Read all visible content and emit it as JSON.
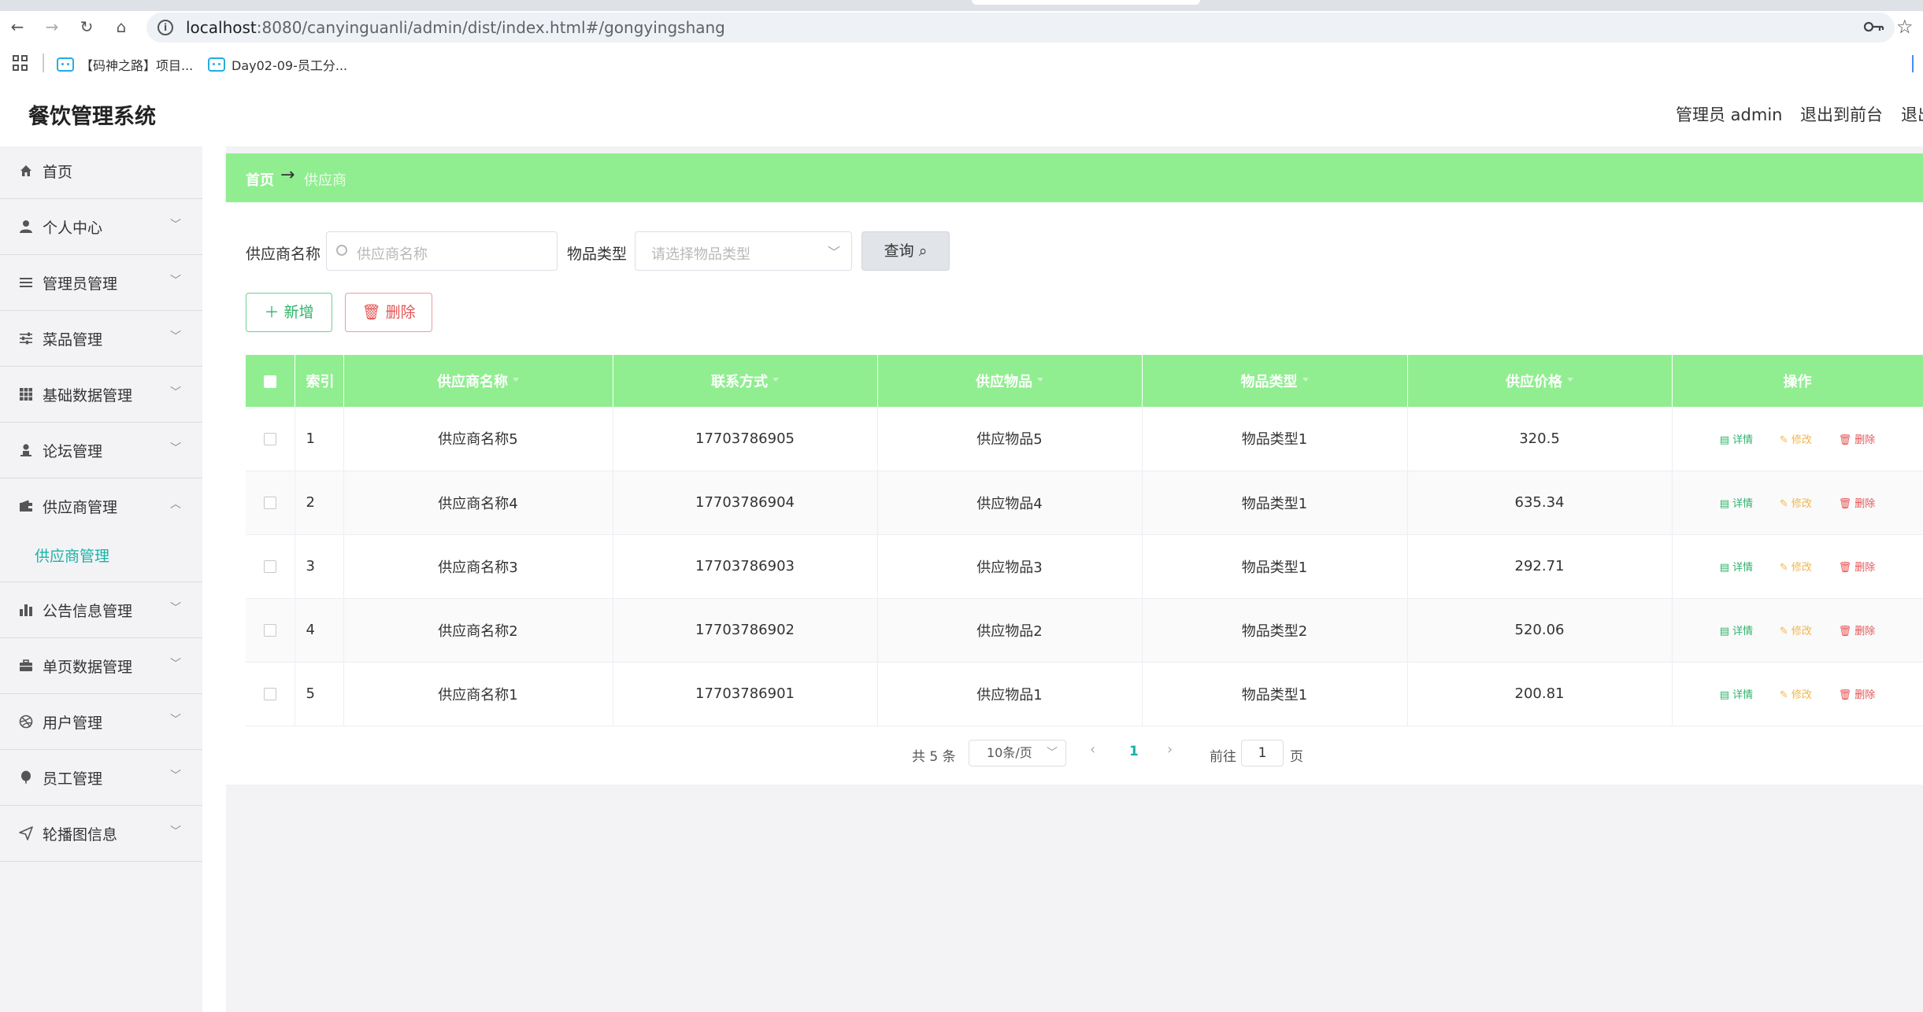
{
  "browser": {
    "url_host": "localhost",
    "url_path": ":8080/canyinguanli/admin/dist/index.html#/gongyingshang",
    "bookmarks": [
      "【码神之路】项目...",
      "Day02-09-员工分..."
    ]
  },
  "header": {
    "title": "餐饮管理系统",
    "user": "管理员 admin",
    "to_front": "退出到前台",
    "logout": "退出"
  },
  "sidebar": {
    "items": [
      {
        "label": "首页",
        "icon": "home-icon"
      },
      {
        "label": "个人中心",
        "icon": "user-icon"
      },
      {
        "label": "管理员管理",
        "icon": "list-icon"
      },
      {
        "label": "菜品管理",
        "icon": "sliders-icon"
      },
      {
        "label": "基础数据管理",
        "icon": "grid-icon"
      },
      {
        "label": "论坛管理",
        "icon": "person-icon"
      },
      {
        "label": "供应商管理",
        "icon": "wallet-icon"
      },
      {
        "label": "公告信息管理",
        "icon": "bar-chart-icon"
      },
      {
        "label": "单页数据管理",
        "icon": "briefcase-icon"
      },
      {
        "label": "用户管理",
        "icon": "dribbble-icon"
      },
      {
        "label": "员工管理",
        "icon": "balloon-icon"
      },
      {
        "label": "轮播图信息",
        "icon": "send-icon"
      }
    ],
    "active_sub": "供应商管理"
  },
  "breadcrumb": {
    "home": "首页",
    "arrow": "→",
    "current": "供应商"
  },
  "filters": {
    "name_label": "供应商名称",
    "name_placeholder": "供应商名称",
    "type_label": "物品类型",
    "type_placeholder": "请选择物品类型",
    "query": "查询"
  },
  "actions": {
    "add": "新增",
    "delete": "删除"
  },
  "table": {
    "headers": [
      "索引",
      "供应商名称",
      "联系方式",
      "供应物品",
      "物品类型",
      "供应价格",
      "操作"
    ],
    "ops": {
      "detail": "详情",
      "edit": "修改",
      "remove": "删除"
    },
    "rows": [
      {
        "idx": "1",
        "name": "供应商名称5",
        "phone": "17703786905",
        "goods": "供应物品5",
        "type": "物品类型1",
        "price": "320.5"
      },
      {
        "idx": "2",
        "name": "供应商名称4",
        "phone": "17703786904",
        "goods": "供应物品4",
        "type": "物品类型1",
        "price": "635.34"
      },
      {
        "idx": "3",
        "name": "供应商名称3",
        "phone": "17703786903",
        "goods": "供应物品3",
        "type": "物品类型1",
        "price": "292.71"
      },
      {
        "idx": "4",
        "name": "供应商名称2",
        "phone": "17703786902",
        "goods": "供应物品2",
        "type": "物品类型2",
        "price": "520.06"
      },
      {
        "idx": "5",
        "name": "供应商名称1",
        "phone": "17703786901",
        "goods": "供应物品1",
        "type": "物品类型1",
        "price": "200.81"
      }
    ]
  },
  "pagination": {
    "total": "共 5 条",
    "size": "10条/页",
    "current": "1",
    "goto": "前往",
    "goto_value": "1",
    "page": "页"
  },
  "colors": {
    "accent": "#90ee90",
    "active": "#19b3a8",
    "success": "#2fb56a",
    "warning": "#f2b64c",
    "danger": "#e55353"
  }
}
